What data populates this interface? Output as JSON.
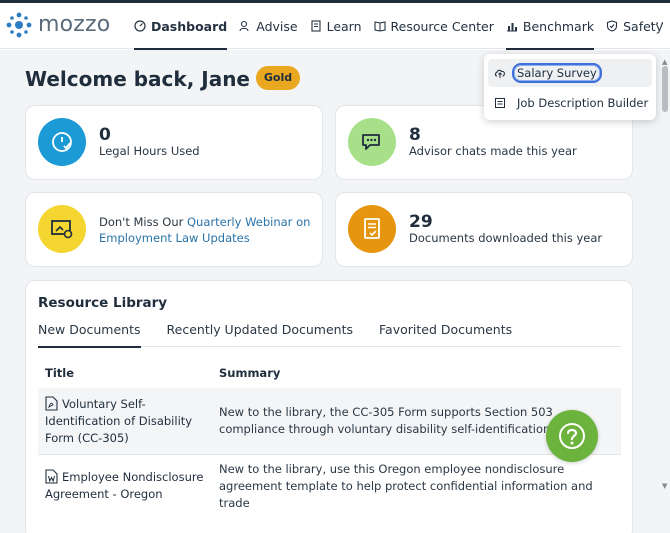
{
  "app": {
    "logo_text": "mozzo"
  },
  "nav": {
    "items": [
      {
        "label": "Dashboard",
        "icon": "gauge-icon"
      },
      {
        "label": "Advise",
        "icon": "person-search-icon"
      },
      {
        "label": "Learn",
        "icon": "book-icon"
      },
      {
        "label": "Resource Center",
        "icon": "open-book-icon"
      },
      {
        "label": "Benchmark",
        "icon": "bar-chart-icon"
      },
      {
        "label": "Safety",
        "icon": "shield-icon"
      }
    ],
    "more": "···"
  },
  "benchmark_menu": {
    "items": [
      {
        "label": "Salary Survey",
        "icon": "cloud-upload-icon"
      },
      {
        "label": "Job Description Builder",
        "icon": "document-list-icon"
      }
    ]
  },
  "welcome": {
    "heading": "Welcome back, Jane",
    "tier_badge": "Gold"
  },
  "stats": [
    {
      "value": "0",
      "label": "Legal Hours Used",
      "icon": "clock-check-icon",
      "color": "#1b9ad6"
    },
    {
      "value": "8",
      "label": "Advisor chats made this year",
      "icon": "chat-bubbles-icon",
      "color": "#a8e08a"
    },
    {
      "value": "29",
      "label": "Documents downloaded this year",
      "icon": "document-check-icon",
      "color": "#e6950f"
    }
  ],
  "promo": {
    "prefix": "Don't Miss Our ",
    "link": "Quarterly Webinar on Employment Law Updates",
    "icon": "screen-play-icon",
    "color": "#f5d530"
  },
  "library": {
    "title": "Resource Library",
    "tabs": [
      "New Documents",
      "Recently Updated Documents",
      "Favorited Documents"
    ],
    "columns": [
      "Title",
      "Summary"
    ],
    "rows": [
      {
        "icon": "pdf-file-icon",
        "title": "Voluntary Self-Identification of Disability Form (CC-305)",
        "summary": "New to the library, the CC-305 Form supports Section 503 compliance through voluntary disability self-identification."
      },
      {
        "icon": "word-file-icon",
        "title": "Employee Nondisclosure Agreement - Oregon",
        "summary": "New to the library, use this Oregon employee nondisclosure agreement template to help protect confidential information and trade"
      }
    ]
  },
  "help": {
    "icon": "question-mark-icon"
  },
  "colors": {
    "ink": "#1f2d3d",
    "link": "#2a73a8",
    "help_green": "#6bb33c",
    "badge_gold": "#e9a820"
  }
}
